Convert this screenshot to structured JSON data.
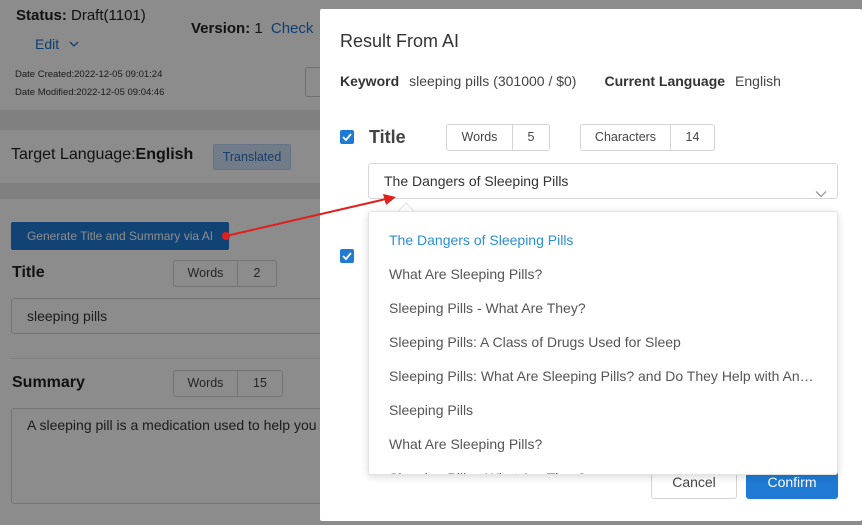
{
  "page": {
    "status_label": "Status:",
    "status_value": "Draft(1101)",
    "edit_label": "Edit",
    "version_label": "Version:",
    "version_value": "1",
    "check_label": "Check",
    "date_created": "Date Created:2022-12-05 09:01:24",
    "date_modified": "Date Modified:2022-12-05 09:04:46",
    "target_language_label": "Target Language:",
    "target_language_value": "English",
    "translated_label": "Translated",
    "generate_button": "Generate Title and Summary via AI",
    "title_section": {
      "label": "Title",
      "words_label": "Words",
      "words_value": "2",
      "input_value": "sleeping pills"
    },
    "summary_section": {
      "label": "Summary",
      "words_label": "Words",
      "words_value": "15",
      "text_value": "A sleeping pill is a medication used to help you"
    }
  },
  "modal": {
    "title": "Result From AI",
    "keyword_label": "Keyword",
    "keyword_value": "sleeping pills (301000 / $0)",
    "current_language_label": "Current Language",
    "current_language_value": "English",
    "title_section": {
      "label": "Title",
      "words_label": "Words",
      "words_value": "5",
      "characters_label": "Characters",
      "characters_value": "14",
      "selected_value": "The Dangers of Sleeping Pills"
    },
    "dropdown_options": [
      "The Dangers of Sleeping Pills",
      "What Are Sleeping Pills?",
      "Sleeping Pills - What Are They?",
      "Sleeping Pills: A Class of Drugs Used for Sleep",
      "Sleeping Pills: What Are Sleeping Pills? and Do They Help with Anxiety?",
      "Sleeping Pills",
      "What Are Sleeping Pills?",
      "Sleeping Pills - What Are They?"
    ],
    "cancel_label": "Cancel",
    "confirm_label": "Confirm"
  },
  "colors": {
    "primary": "#1f7ad4",
    "link": "#1a73c8",
    "active_option": "#2a8fd4",
    "arrow": "#e0201c",
    "overlay": "rgba(0,0,0,0.45)"
  },
  "icons": [
    "chevron-down-icon",
    "checkbox-checked-icon",
    "annotation-arrow"
  ]
}
